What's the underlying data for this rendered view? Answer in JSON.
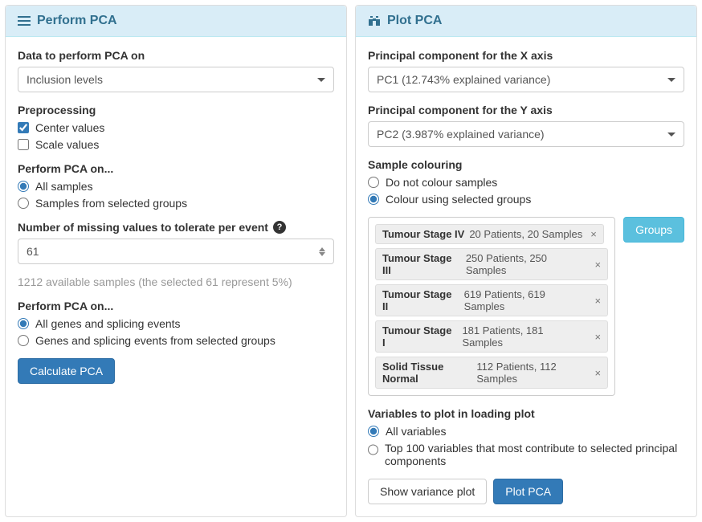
{
  "perform": {
    "title": "Perform PCA",
    "data_on_label": "Data to perform PCA on",
    "data_on_value": "Inclusion levels",
    "preprocessing_label": "Preprocessing",
    "center_label": "Center values",
    "scale_label": "Scale values",
    "center_checked": true,
    "scale_checked": false,
    "pca_on_1_label": "Perform PCA on...",
    "samples_all_label": "All samples",
    "samples_selected_label": "Samples from selected groups",
    "samples_choice": "all",
    "missing_label": "Number of missing values to tolerate per event",
    "missing_value": "61",
    "summary": "1212 available samples (the selected 61 represent 5%)",
    "pca_on_2_label": "Perform PCA on...",
    "genes_all_label": "All genes and splicing events",
    "genes_selected_label": "Genes and splicing events from selected groups",
    "genes_choice": "all",
    "calculate_btn": "Calculate PCA"
  },
  "plot": {
    "title": "Plot PCA",
    "x_label": "Principal component for the X axis",
    "x_value": "PC1 (12.743% explained variance)",
    "y_label": "Principal component for the Y axis",
    "y_value": "PC2 (3.987% explained variance)",
    "colouring_label": "Sample colouring",
    "col_none_label": "Do not colour samples",
    "col_groups_label": "Colour using selected groups",
    "col_choice": "groups",
    "groups_btn": "Groups",
    "tags": [
      {
        "name": "Tumour Stage IV",
        "meta": "20 Patients, 20 Samples"
      },
      {
        "name": "Tumour Stage III",
        "meta": "250 Patients, 250 Samples"
      },
      {
        "name": "Tumour Stage II",
        "meta": "619 Patients, 619 Samples"
      },
      {
        "name": "Tumour Stage I",
        "meta": "181 Patients, 181 Samples"
      },
      {
        "name": "Solid Tissue Normal",
        "meta": "112 Patients, 112 Samples"
      }
    ],
    "vars_label": "Variables to plot in loading plot",
    "vars_all_label": "All variables",
    "vars_top_label": "Top 100 variables that most contribute to selected principal components",
    "vars_choice": "all",
    "variance_btn": "Show variance plot",
    "plot_btn": "Plot PCA"
  }
}
